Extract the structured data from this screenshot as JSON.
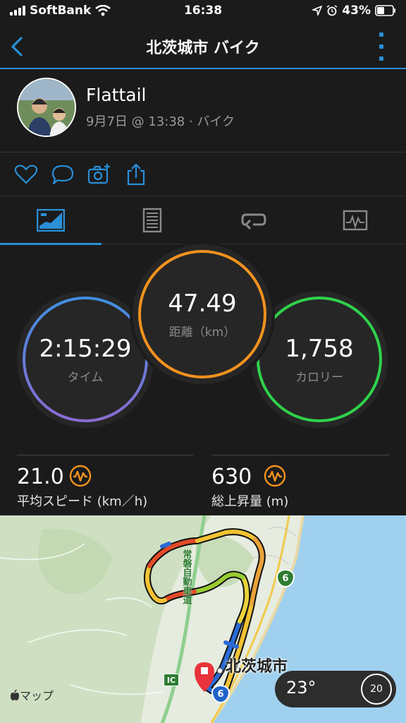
{
  "status_bar": {
    "carrier": "SoftBank",
    "time": "16:38",
    "battery": "43%"
  },
  "nav": {
    "title": "北茨城市 バイク"
  },
  "profile": {
    "name": "Flattail",
    "meta": "9月7日 @ 13:38 · バイク"
  },
  "social": {
    "icons": [
      "heart-icon",
      "comment-icon",
      "camera-add-icon",
      "share-icon"
    ]
  },
  "tabs": {
    "icons": [
      "overview-icon",
      "details-icon",
      "laps-icon",
      "charts-icon"
    ],
    "active": 0
  },
  "colors": {
    "accent": "#2a8fd6",
    "time_ring": "#7a6fcf",
    "distance_ring": "#f3921e",
    "calories_ring": "#2fd24a",
    "wave": "#f3921e"
  },
  "summary": {
    "time": {
      "value": "2:15:29",
      "label": "タイム"
    },
    "distance": {
      "value": "47.49",
      "label": "距離（km）"
    },
    "calories": {
      "value": "1,758",
      "label": "カロリー"
    }
  },
  "stats": {
    "avg_speed": {
      "value": "21.0",
      "label": "平均スピード (km／h)"
    },
    "elevation_gain": {
      "value": "630",
      "label": "総上昇量 (m)"
    }
  },
  "map": {
    "city": "北茨城市",
    "attribution": "マップ",
    "highway_label": "常磐自動車道",
    "route_shield": "6",
    "ic_label": "IC"
  },
  "weather": {
    "temp": "23°",
    "wind": "20"
  }
}
